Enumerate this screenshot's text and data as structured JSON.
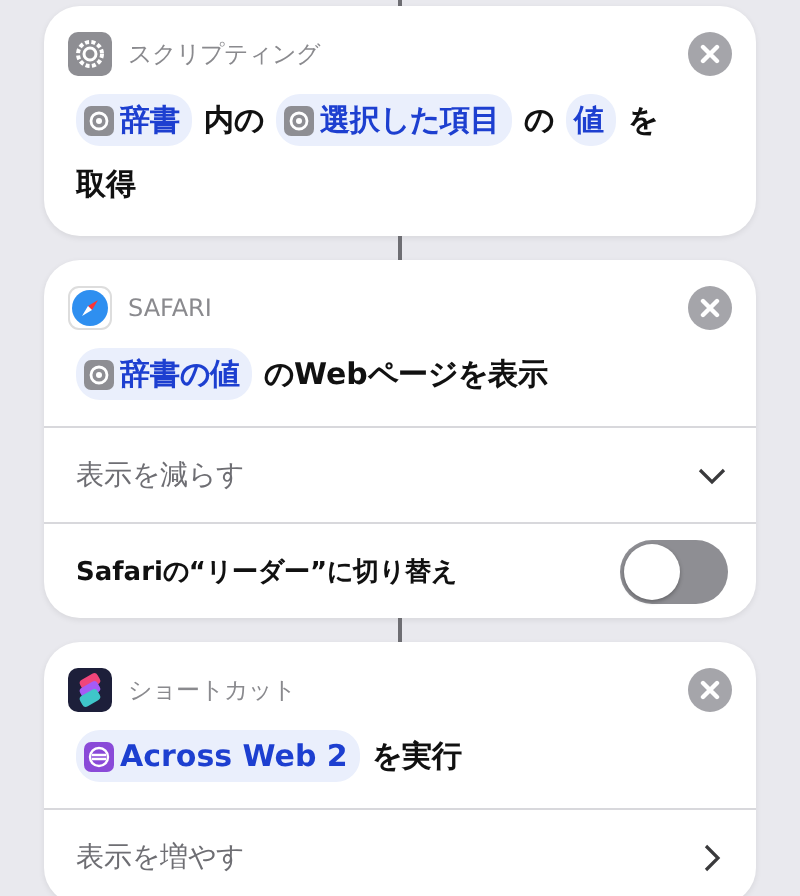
{
  "actions": [
    {
      "kind": "scripting",
      "category": "スクリプティング",
      "sentence": [
        {
          "kind": "variable",
          "text": "辞書"
        },
        {
          "kind": "text",
          "text": "内の"
        },
        {
          "kind": "variable",
          "text": "選択した項目"
        },
        {
          "kind": "text",
          "text": "の"
        },
        {
          "kind": "value",
          "text": "値"
        },
        {
          "kind": "text",
          "text": "を"
        },
        {
          "kind": "text",
          "text": "取得"
        }
      ]
    },
    {
      "kind": "safari",
      "category": "SAFARI",
      "sentence": [
        {
          "kind": "variable",
          "text": "辞書の値"
        },
        {
          "kind": "text",
          "text": "のWebページを表示"
        }
      ],
      "rows": [
        {
          "kind": "disclosure",
          "label": "表示を減らす",
          "expanded": true
        },
        {
          "kind": "toggle",
          "label": "Safariの“リーダー”に切り替え",
          "on": false
        }
      ]
    },
    {
      "kind": "shortcuts",
      "category": "ショートカット",
      "sentence": [
        {
          "kind": "shortcut",
          "text": "Across Web 2"
        },
        {
          "kind": "text",
          "text": "を実行"
        }
      ],
      "rows": [
        {
          "kind": "disclosure",
          "label": "表示を増やす",
          "expanded": false
        }
      ]
    }
  ]
}
